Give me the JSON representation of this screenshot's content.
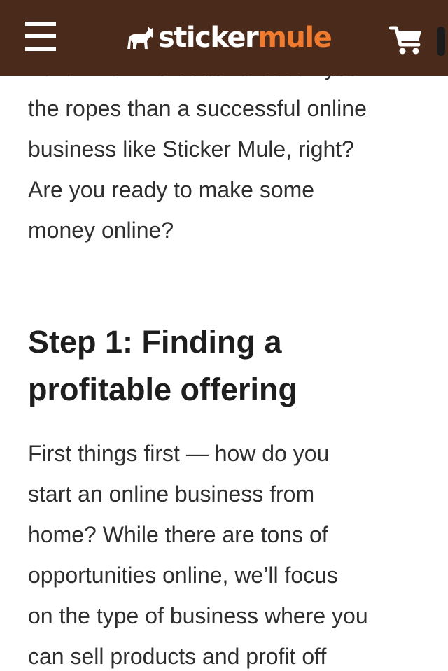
{
  "header": {
    "menu_icon": "hamburger-menu-icon",
    "logo": {
      "icon": "mule-logo-icon",
      "part1": "sticker",
      "part2": "mule"
    },
    "cart_icon": "shopping-cart-icon",
    "colors": {
      "background": "#4a2a1a",
      "accent": "#f07a2e",
      "text": "#ffffff"
    }
  },
  "article": {
    "intro_lines": [
      "next! And who better to teach you",
      "the ropes than a successful online",
      "business like Sticker Mule, right?",
      "Are you ready to make some",
      "money online?"
    ],
    "step_heading_lines": [
      "Step 1: Finding a",
      "profitable offering"
    ],
    "body_lines": [
      "First things first — how do you",
      "start an online business from",
      "home? While there are tons of",
      "opportunities online, we’ll focus",
      "on the type of business where you",
      "can sell products and profit off"
    ]
  }
}
